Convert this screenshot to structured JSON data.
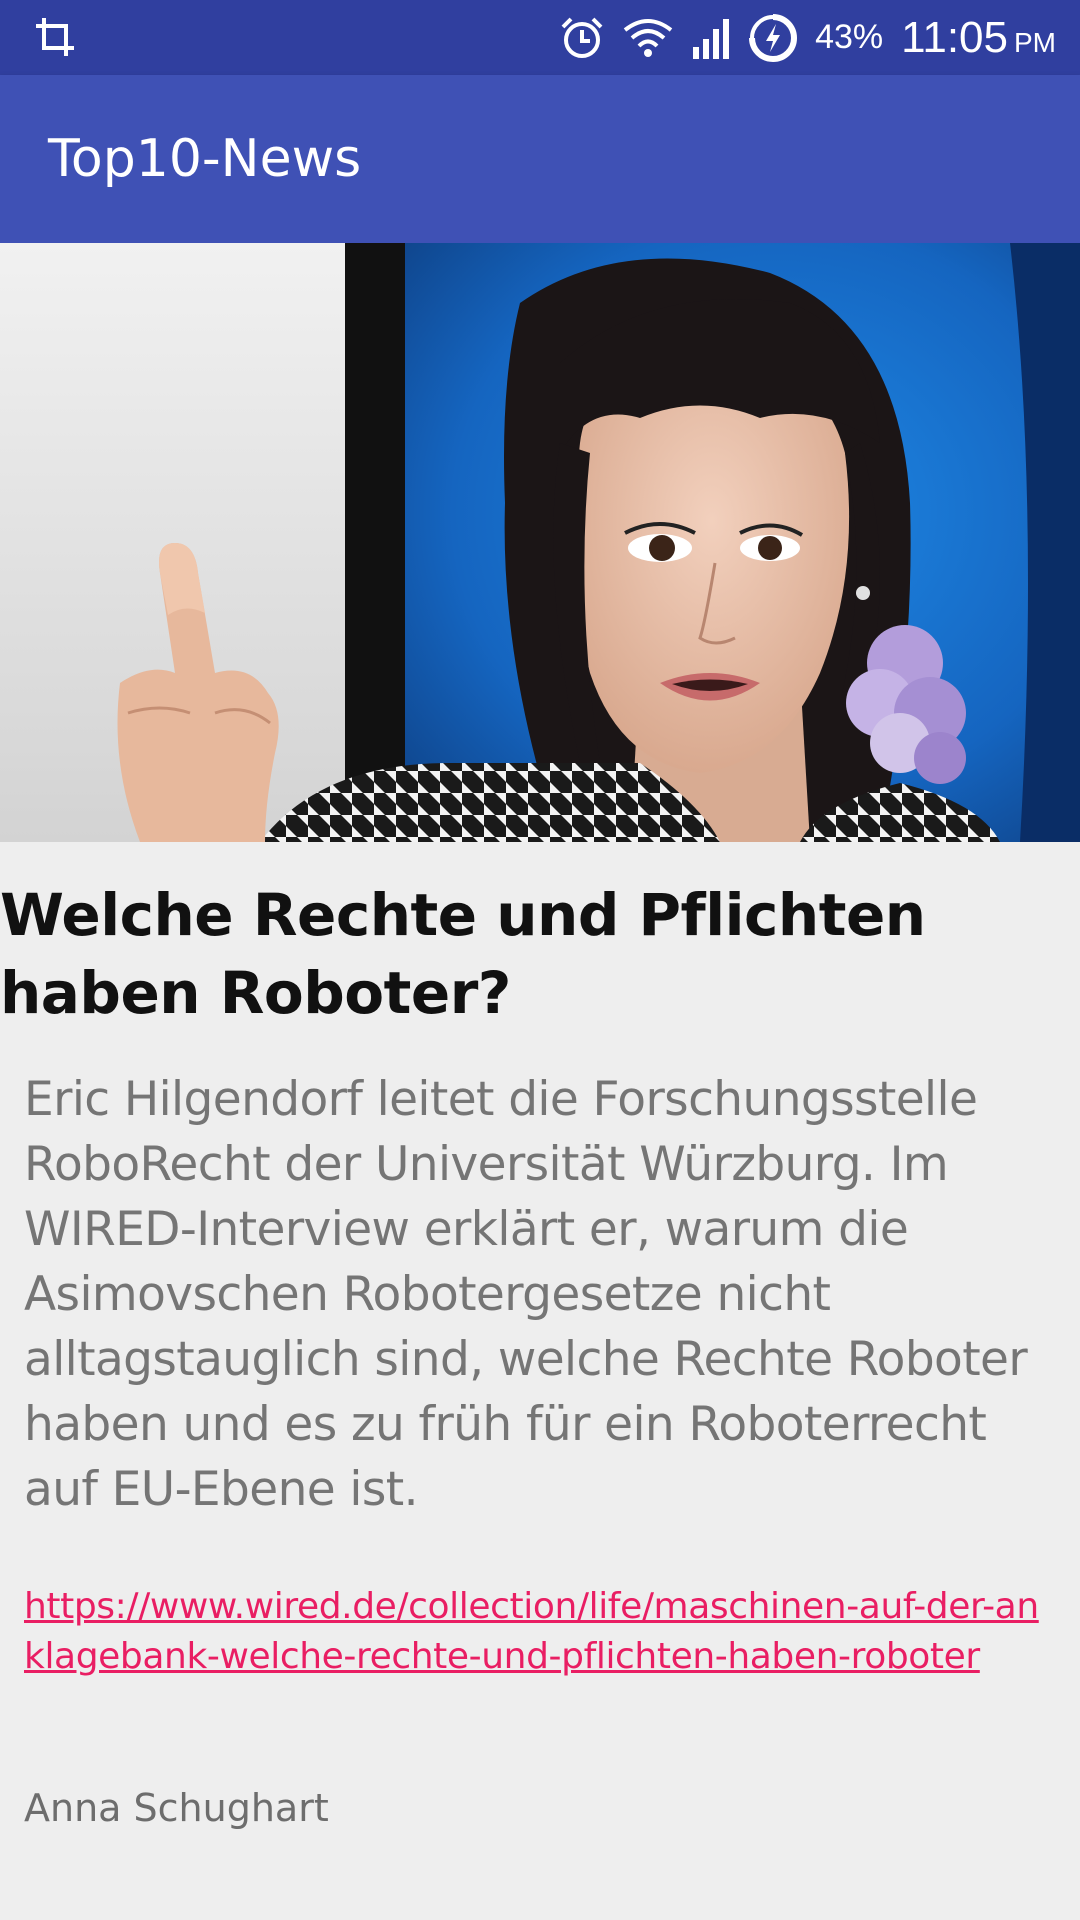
{
  "status_bar": {
    "battery_percent": "43%",
    "time": "11:05",
    "ampm": "PM",
    "icons": [
      "crop-icon",
      "alarm-icon",
      "wifi-icon",
      "signal-icon",
      "battery-charging-icon"
    ]
  },
  "app_bar": {
    "title": "Top10-News"
  },
  "article": {
    "image_icon": "news-photo-image",
    "headline": "Welche Rechte und Pflichten haben Roboter?",
    "summary": "Eric Hilgendorf leitet die Forschungsstelle RoboRecht der Universität Würzburg. Im WIRED-Interview erklärt er, warum die Asimovschen Robotergesetze nicht alltagstauglich sind, welche Rechte Roboter haben und es zu früh für ein Roboterrecht auf EU-Ebene ist.",
    "link": "https://www.wired.de/collection/life/maschinen-auf-der-anklagebank-welche-rechte-und-pflichten-haben-roboter",
    "author": "Anna Schughart"
  },
  "colors": {
    "status_bar": "#303f9f",
    "app_bar": "#3f51b5",
    "background": "#eeeeee",
    "link": "#e91e63",
    "summary_text": "#757575"
  }
}
